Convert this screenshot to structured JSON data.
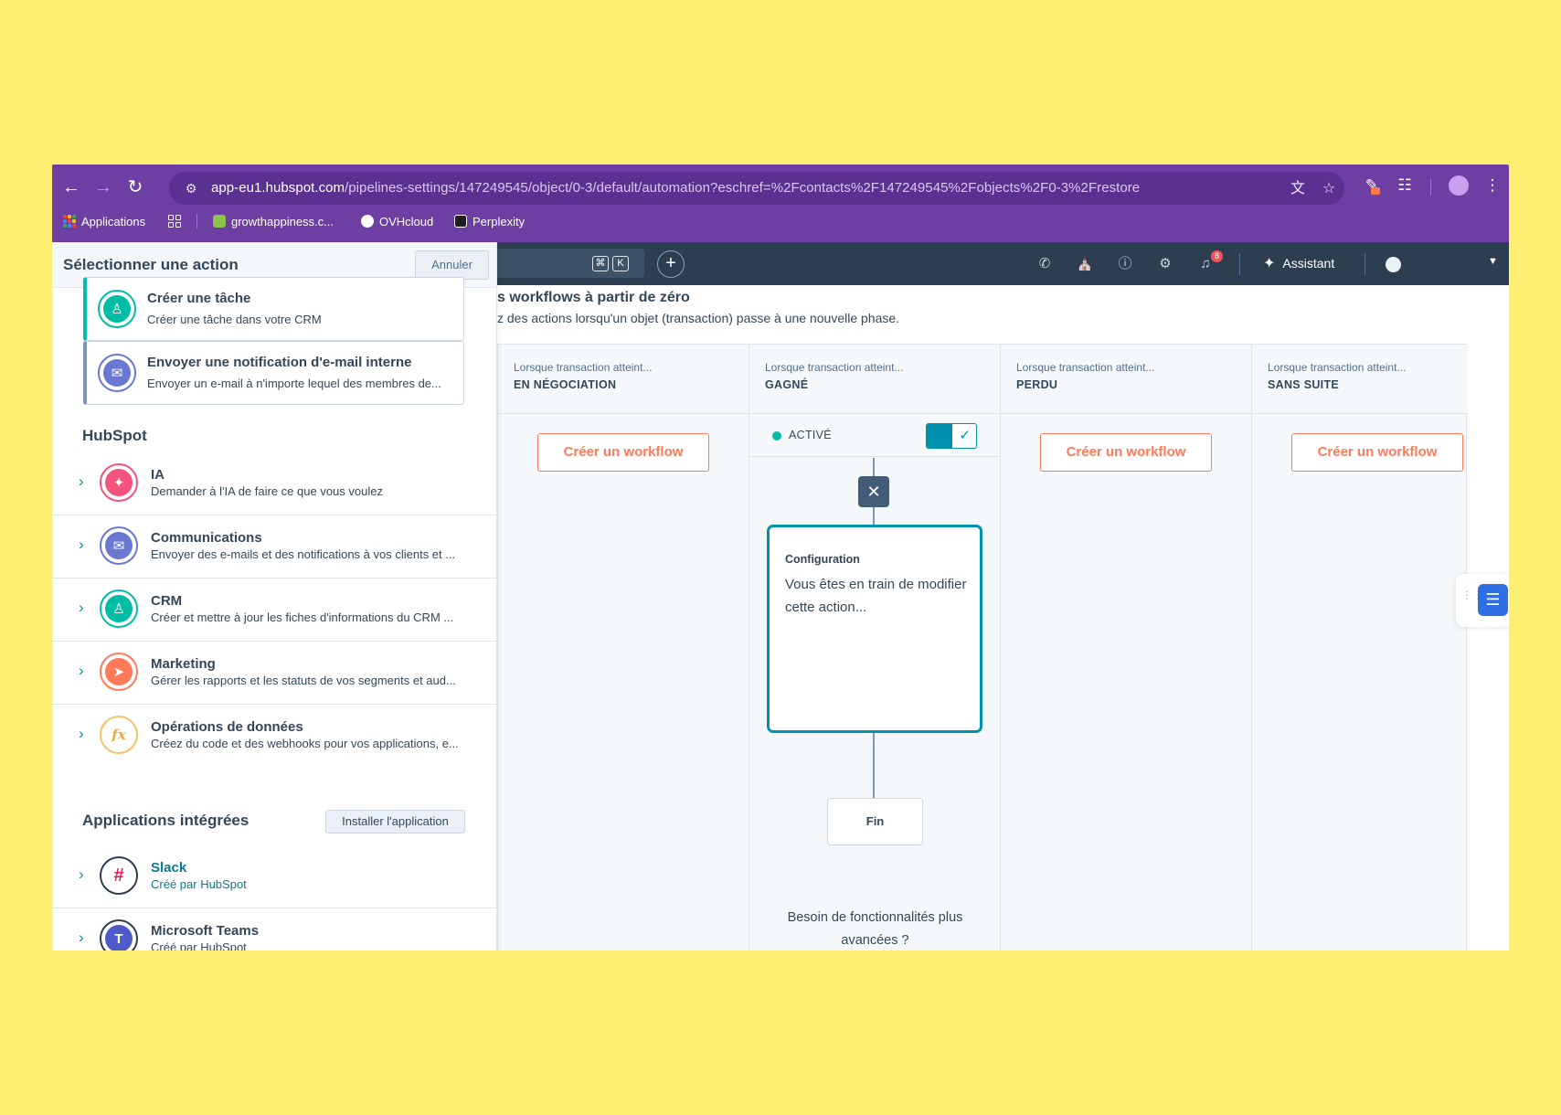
{
  "browser": {
    "url_host": "app-eu1.hubspot.com",
    "url_path": "/pipelines-settings/147249545/object/0-3/default/automation?eschref=%2Fcontacts%2F147249545%2Fobjects%2F0-3%2Frestore",
    "bookmarks": [
      {
        "label": "Applications",
        "icon": "apps-grid-icon"
      },
      {
        "label": "growthappiness.c...",
        "icon": "growthappiness-favicon"
      },
      {
        "label": "OVHcloud",
        "icon": "ovhcloud-favicon"
      },
      {
        "label": "Perplexity",
        "icon": "perplexity-favicon"
      }
    ]
  },
  "hubspot_nav": {
    "search_shortcut": [
      "⌘",
      "K"
    ],
    "assistant_label": "Assistant",
    "notification_count": "8"
  },
  "panel": {
    "title": "Sélectionner une action",
    "cancel_label": "Annuler",
    "actions": [
      {
        "title": "Créer une tâche",
        "description": "Créer une tâche dans votre CRM",
        "icon": "crm-people-icon"
      },
      {
        "title": "Envoyer une notification d'e-mail interne",
        "description": "Envoyer un e-mail à n'importe lequel des membres de...",
        "icon": "email-icon"
      }
    ],
    "hubspot_section_title": "HubSpot",
    "categories": [
      {
        "title": "IA",
        "description": "Demander à l'IA de faire ce que vous voulez",
        "icon": "ai-sparkle-icon",
        "color": "#f2547d"
      },
      {
        "title": "Communications",
        "description": "Envoyer des e-mails et des notifications à vos clients et ...",
        "icon": "email-icon",
        "color": "#6a78d1"
      },
      {
        "title": "CRM",
        "description": "Créer et mettre à jour les fiches d'informations du CRM ...",
        "icon": "crm-people-icon",
        "color": "#00bda5"
      },
      {
        "title": "Marketing",
        "description": "Gérer les rapports et les statuts de vos segments et aud...",
        "icon": "megaphone-icon",
        "color": "#ff7a59"
      },
      {
        "title": "Opérations de données",
        "description": "Créez du code et des webhooks pour vos applications, e...",
        "icon": "function-fx-icon",
        "color": "#f5c26b"
      }
    ],
    "integrations_section_title": "Applications intégrées",
    "install_label": "Installer l'application",
    "integrations": [
      {
        "title": "Slack",
        "description": "Créé par HubSpot",
        "icon": "slack-icon"
      },
      {
        "title": "Microsoft Teams",
        "description": "Créé par HubSpot",
        "icon": "teams-icon"
      }
    ]
  },
  "main": {
    "title": "s workflows à partir de zéro",
    "subtitle": "z des actions lorsqu'un objet (transaction) passe à une nouvelle phase.",
    "columns": [
      {
        "trigger": "Lorsque transaction atteint...",
        "stage": "EN NÉGOCIATION",
        "button": "Créer un workflow"
      },
      {
        "trigger": "Lorsque transaction atteint...",
        "stage": "GAGNÉ",
        "status": "ACTIVÉ"
      },
      {
        "trigger": "Lorsque transaction atteint...",
        "stage": "PERDU",
        "button": "Créer un workflow"
      },
      {
        "trigger": "Lorsque transaction atteint...",
        "stage": "SANS SUITE",
        "button": "Créer un workflow"
      }
    ],
    "config_card": {
      "title": "Configuration",
      "text": "Vous êtes en train de modifier cette action..."
    },
    "end_label": "Fin",
    "need_more": "Besoin de fonctionnalités plus avancées ?"
  },
  "colors": {
    "browser_chrome": "#6e3fa3",
    "hubspot_nav": "#2d3e50",
    "accent_orange": "#ff7a59",
    "accent_teal": "#0091ae",
    "background": "#fdef72"
  }
}
